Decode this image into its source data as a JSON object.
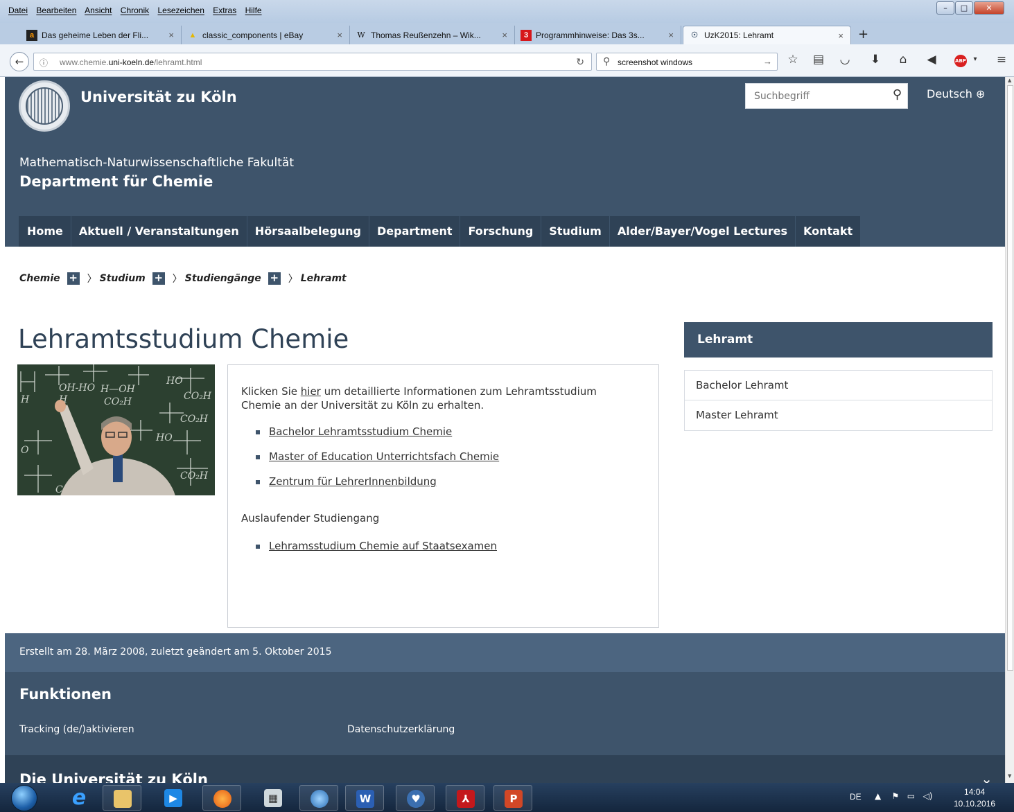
{
  "browser": {
    "menus": [
      "Datei",
      "Bearbeiten",
      "Ansicht",
      "Chronik",
      "Lesezeichen",
      "Extras",
      "Hilfe"
    ],
    "tabs": [
      {
        "favicon": "a",
        "label": "Das geheime Leben der Fli...",
        "close": "×"
      },
      {
        "favicon": "▲",
        "label": "classic_components | eBay",
        "close": "×"
      },
      {
        "favicon": "W",
        "label": "Thomas Reußenzehn – Wik...",
        "close": "×"
      },
      {
        "favicon": "3",
        "label": "Programmhinweise: Das 3s...",
        "close": "×"
      },
      {
        "favicon": "☉",
        "label": "UzK2015: Lehramt",
        "close": "×"
      }
    ],
    "new_tab": "+",
    "url_prefix": "www.chemie.",
    "url_domain": "uni-koeln.de",
    "url_path": "/lehramt.html",
    "search_value": "screenshot windows",
    "window_controls": {
      "minimize": "–",
      "maximize": "□",
      "close": "✕"
    }
  },
  "site": {
    "university": "Universität zu Köln",
    "search_placeholder": "Suchbegriff",
    "language": "Deutsch",
    "faculty": "Mathematisch-Naturwissenschaftliche Fakultät",
    "department": "Department für Chemie",
    "nav": [
      "Home",
      "Aktuell / Veranstaltungen",
      "Hörsaalbelegung",
      "Department",
      "Forschung",
      "Studium",
      "Alder/Bayer/Vogel Lectures",
      "Kontakt"
    ]
  },
  "breadcrumb": [
    "Chemie",
    "Studium",
    "Studiengänge",
    "Lehramt"
  ],
  "main": {
    "title": "Lehramtsstudium Chemie",
    "intro_before": "Klicken Sie ",
    "intro_link": "hier",
    "intro_after": " um detaillierte Informationen zum Lehramtsstudium Chemie an der Universität zu Köln zu erhalten.",
    "links": [
      "Bachelor Lehramtsstudium Chemie",
      "Master of Education Unterrichtsfach Chemie",
      "Zentrum für LehrerInnenbildung"
    ],
    "sub_heading": "Auslaufender Studiengang",
    "old_links": [
      "Lehramsstudium Chemie auf Staatsexamen"
    ]
  },
  "sidebar": {
    "heading": "Lehramt",
    "items": [
      "Bachelor Lehramt",
      "Master Lehramt"
    ]
  },
  "footer": {
    "created": "Erstellt am  28. März 2008, zuletzt geändert am  5. Oktober 2015",
    "functions_heading": "Funktionen",
    "tracking": "Tracking (de/)aktivieren",
    "privacy": "Datenschutzerklärung",
    "university_heading": "Die Universität zu Köln"
  },
  "taskbar": {
    "language": "DE",
    "time": "14:04",
    "date": "10.10.2016"
  },
  "colors": {
    "brand_dark": "#3e546b",
    "brand_nav": "#2f4256",
    "brand_light": "#4c6580"
  }
}
